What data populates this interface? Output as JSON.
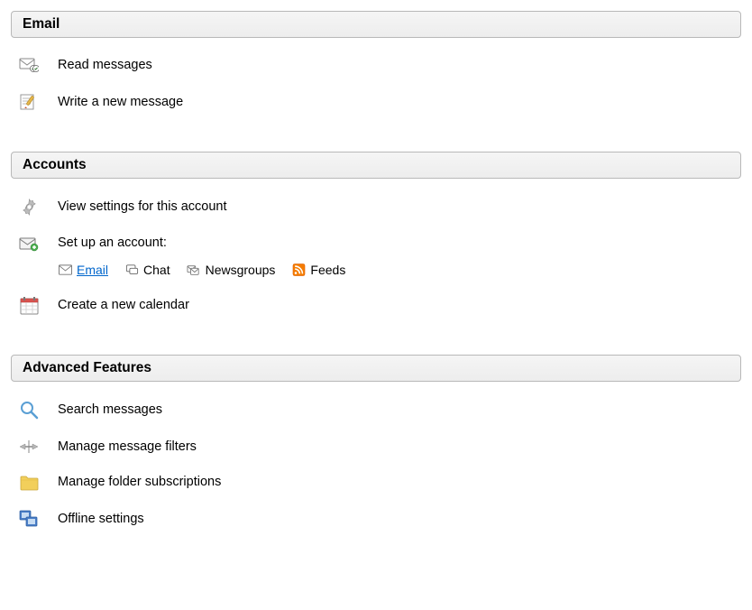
{
  "sections": {
    "email": {
      "title": "Email",
      "read": "Read messages",
      "write": "Write a new message"
    },
    "accounts": {
      "title": "Accounts",
      "view_settings": "View settings for this account",
      "setup_label": "Set up an account:",
      "setup": {
        "email": "Email",
        "chat": "Chat",
        "newsgroups": "Newsgroups",
        "feeds": "Feeds"
      },
      "calendar": "Create a new calendar"
    },
    "advanced": {
      "title": "Advanced Features",
      "search": "Search messages",
      "filters": "Manage message filters",
      "folders": "Manage folder subscriptions",
      "offline": "Offline settings"
    }
  }
}
